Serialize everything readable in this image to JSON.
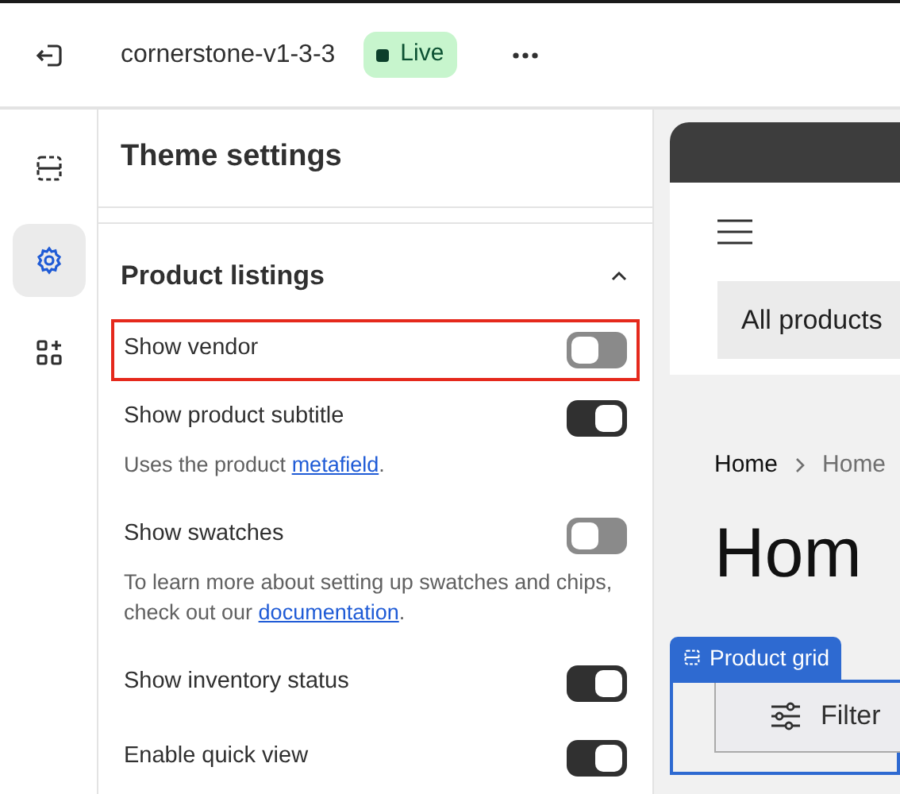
{
  "topbar": {
    "theme_name": "cornerstone-v1-3-3",
    "status": "Live"
  },
  "rail": [
    {
      "kind": "sections",
      "selected": false
    },
    {
      "kind": "settings",
      "selected": true
    },
    {
      "kind": "apps",
      "selected": false
    }
  ],
  "panel": {
    "title": "Theme settings",
    "section": {
      "title": "Product listings",
      "expanded": true,
      "settings": [
        {
          "label": "Show vendor",
          "on": false,
          "highlighted": true
        },
        {
          "label": "Show product subtitle",
          "on": true,
          "highlighted": false,
          "hint": {
            "before": "Uses the product ",
            "link": "metafield",
            "after": "."
          }
        },
        {
          "label": "Show swatches",
          "on": false,
          "highlighted": false,
          "hint": {
            "before": "To learn more about setting up swatches and chips, check out our ",
            "link": "documentation",
            "after": "."
          }
        },
        {
          "label": "Show inventory status",
          "on": true,
          "highlighted": false
        },
        {
          "label": "Enable quick view",
          "on": true,
          "highlighted": false
        }
      ]
    }
  },
  "preview": {
    "search_label": "All products",
    "breadcrumb": [
      "Home",
      "Home"
    ],
    "page_title": "Hom",
    "block_tag": "Product grid",
    "filter_button": "Filter"
  }
}
